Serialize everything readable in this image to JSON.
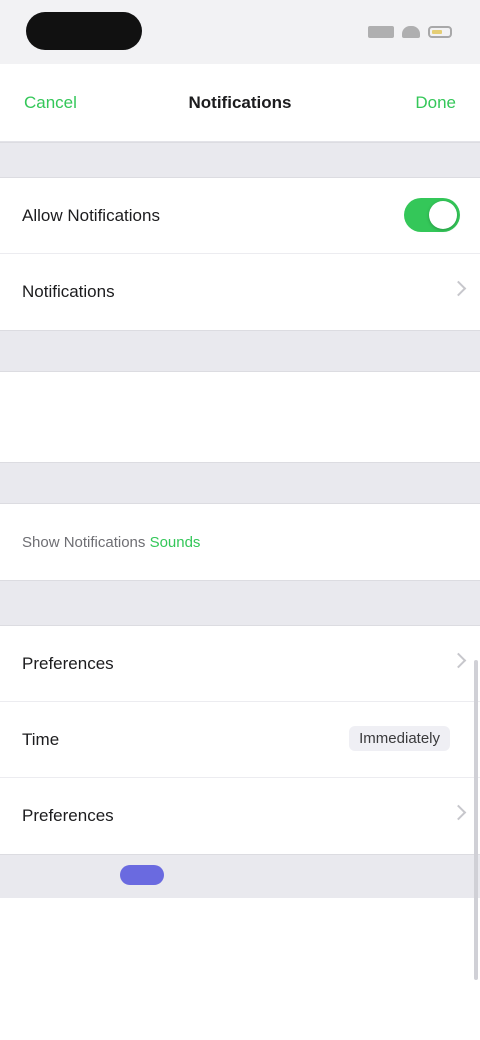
{
  "status_bar": {
    "icons": [
      "signal-icon",
      "wifi-icon",
      "battery-icon"
    ]
  },
  "nav": {
    "back_label": "Cancel",
    "title": "Notifications",
    "action_label": "Done"
  },
  "group_notifications": {
    "rows": [
      {
        "label": "Allow Notifications",
        "toggle_on": true
      },
      {
        "label": "Notifications"
      }
    ]
  },
  "group_link": {
    "text_prefix": "Show Notifications ",
    "text_accent": "Sounds"
  },
  "group_details": {
    "rows": [
      {
        "label": "Preferences"
      },
      {
        "label": "Time",
        "value": "Immediately"
      },
      {
        "label": "Preferences"
      }
    ]
  },
  "colors": {
    "accent": "#34c759",
    "background": "#ffffff",
    "group_gap": "#e9e9ee",
    "page_dot": "#6a6ae0"
  }
}
